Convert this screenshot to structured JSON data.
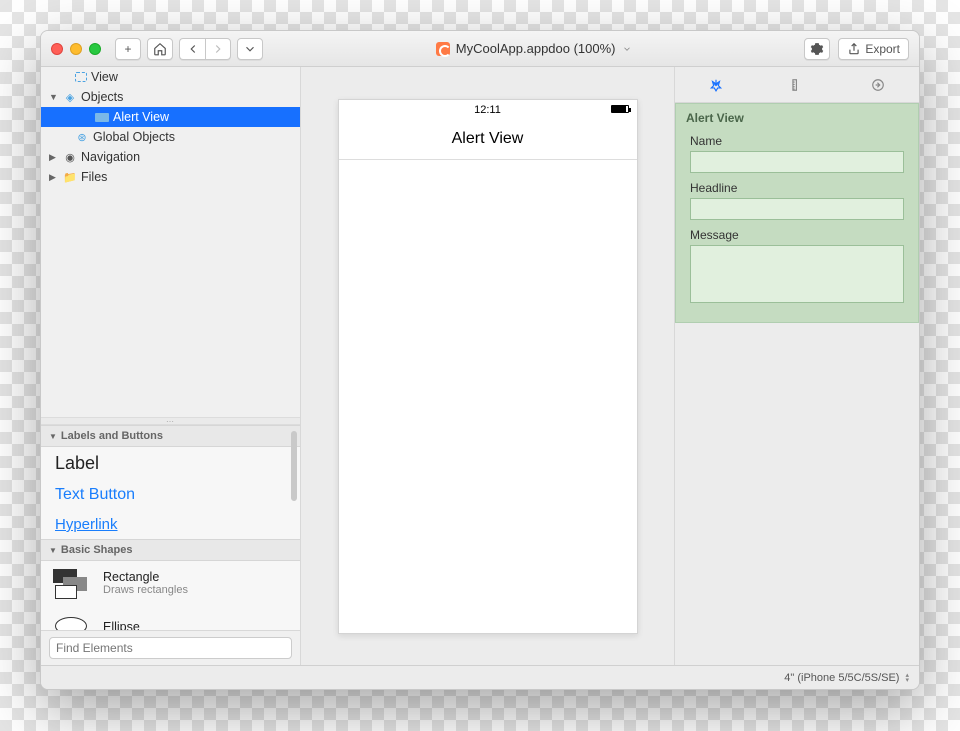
{
  "titlebar": {
    "title": "MyCoolApp.appdoo (100%)",
    "export_label": "Export"
  },
  "tree": {
    "view": "View",
    "objects": "Objects",
    "alert_view": "Alert View",
    "global_objects": "Global Objects",
    "navigation": "Navigation",
    "files": "Files"
  },
  "palette": {
    "hdr_labels": "Labels and Buttons",
    "item_label": "Label",
    "item_textbutton": "Text Button",
    "item_hyperlink": "Hyperlink",
    "hdr_shapes": "Basic Shapes",
    "rect_t": "Rectangle",
    "rect_s": "Draws rectangles",
    "ellipse_t": "Ellipse",
    "find_placeholder": "Find Elements"
  },
  "device": {
    "time": "12:11",
    "nav_title": "Alert View"
  },
  "inspector": {
    "panel_title": "Alert View",
    "name_label": "Name",
    "name_value": "",
    "headline_label": "Headline",
    "headline_value": "",
    "message_label": "Message",
    "message_value": ""
  },
  "status": {
    "device": "4\" (iPhone 5/5C/5S/SE)"
  }
}
